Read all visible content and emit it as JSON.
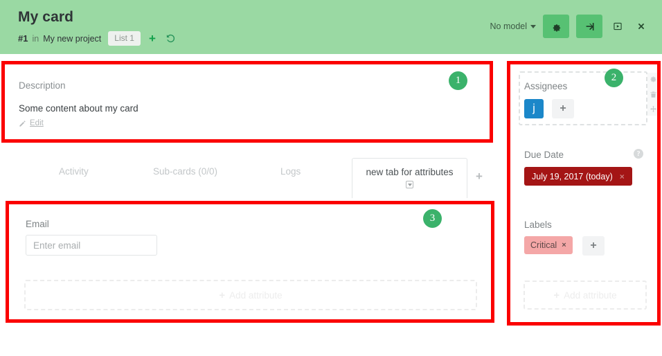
{
  "header": {
    "title": "My card",
    "card_number": "#1",
    "in_word": "in",
    "project": "My new project",
    "list_chip": "List 1",
    "add_icon": "plus-icon",
    "history_icon": "history-icon",
    "model_selector": "No model",
    "gear_icon": "gear-icon",
    "signin_icon": "sign-in-icon",
    "play_box_icon": "play-box-icon",
    "close_icon": "close-icon",
    "background_color": "#9ad9a3",
    "button_color": "#57c173"
  },
  "annotations": {
    "badge_1": "1",
    "badge_2": "2",
    "badge_3": "3",
    "box_color": "#fb0000",
    "badge_color": "#3bb26b"
  },
  "description": {
    "label": "Description",
    "body": "Some content about my card",
    "edit_label": "Edit",
    "pencil_icon": "pencil-icon"
  },
  "tabs": {
    "items": [
      {
        "label": "Activity"
      },
      {
        "label": "Sub-cards (0/0)"
      },
      {
        "label": "Logs"
      }
    ],
    "active": {
      "label": "new tab for attributes",
      "caret_icon": "caret-down-box-icon"
    },
    "add_label": "+"
  },
  "attributes_panel": {
    "email_label": "Email",
    "email_value": "",
    "email_placeholder": "Enter email",
    "add_attribute_label": "Add attribute",
    "add_attribute_plus": "+"
  },
  "sidebar": {
    "assignees": {
      "label": "Assignees",
      "avatar_initial": "j",
      "avatar_color": "#1b87c9",
      "add_label": "+"
    },
    "hover_tools": {
      "gear_icon": "gear-icon",
      "trash_icon": "trash-icon",
      "move_icon": "move-icon"
    },
    "due_date": {
      "label": "Due Date",
      "help_icon": "help-icon",
      "help_char": "?",
      "value": "July 19, 2017 (today)",
      "remove_char": "×",
      "badge_color": "#a41515"
    },
    "labels": {
      "label": "Labels",
      "tags": [
        {
          "text": "Critical",
          "remove_char": "×",
          "color": "#f4a7a7"
        }
      ],
      "add_label": "+"
    },
    "add_attribute_label": "Add attribute",
    "add_attribute_plus": "+"
  }
}
